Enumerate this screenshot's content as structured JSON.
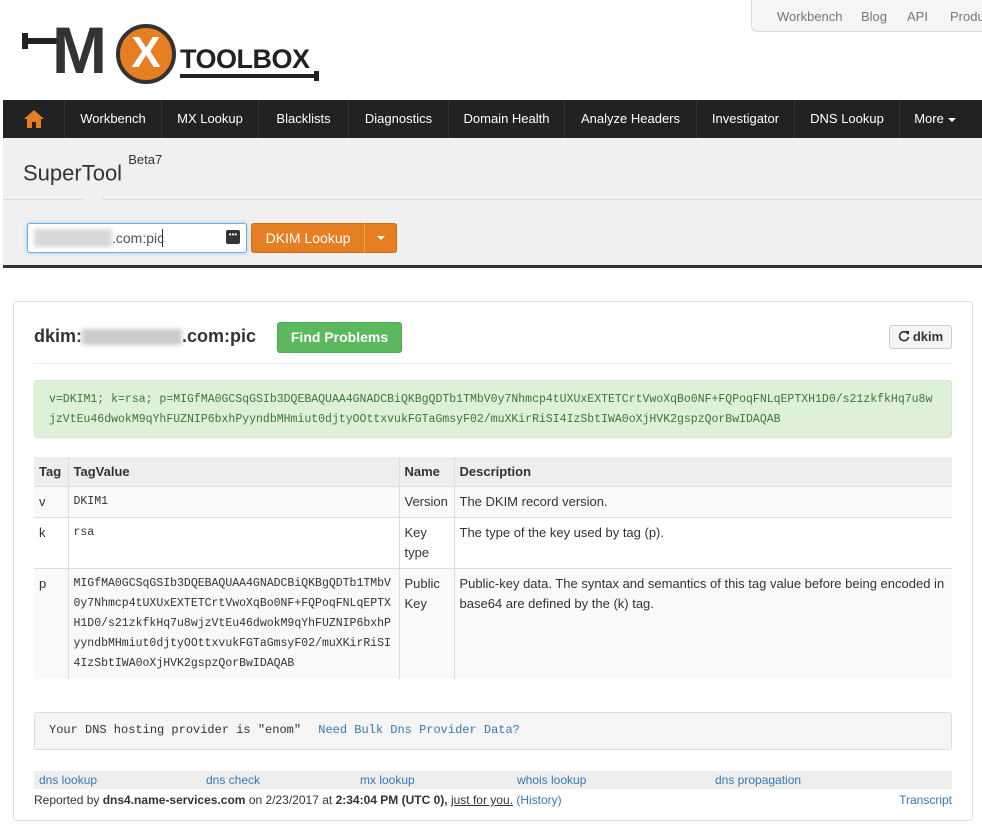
{
  "header": {
    "logo_text": "TOOLBOX",
    "logo_m": "M",
    "logo_x": "X",
    "top_links": [
      "Workbench",
      "Blog",
      "API",
      "Produ"
    ]
  },
  "nav": {
    "items": [
      "Workbench",
      "MX Lookup",
      "Blacklists",
      "Diagnostics",
      "Domain Health",
      "Analyze Headers",
      "Investigator",
      "DNS Lookup",
      "More"
    ]
  },
  "supertool": {
    "title": "SuperTool",
    "beta": "Beta7",
    "search_value": ".com:pic",
    "button_label": "DKIM Lookup"
  },
  "result": {
    "title_prefix": "dkim:",
    "title_suffix": ".com:pic",
    "find_problems_label": "Find Problems",
    "dkim_button_label": "dkim",
    "record": "v=DKIM1; k=rsa; p=MIGfMA0GCSqGSIb3DQEBAQUAA4GNADCBiQKBgQDTb1TMbV0y7Nhmcp4tUXUxEXTETCrtVwoXqBo0NF+FQPoqFNLqEPTXH1D0/s21zkfkHq7u8wjzVtEu46dwokM9qYhFUZNIP6bxhPyyndbMHmiut0djtyOOttxvukFGTaGmsyF02/muXKirRiSI4IzSbtIWA0oXjHVK2gspzQorBwIDAQAB",
    "table": {
      "headers": [
        "Tag",
        "TagValue",
        "Name",
        "Description"
      ],
      "rows": [
        [
          "v",
          "DKIM1",
          "Version",
          "The DKIM record version."
        ],
        [
          "k",
          "rsa",
          "Key type",
          "The type of the key used by tag (p)."
        ],
        [
          "p",
          "MIGfMA0GCSqGSIb3DQEBAQUAA4GNADCBiQKBgQDTb1TMbV0y7Nhmcp4tUXUxEXTETCrtVwoXqBo0NF+FQPoqFNLqEPTXH1D0/s21zkfkHq7u8wjzVtEu46dwokM9qYhFUZNIP6bxhPyyndbMHmiut0djtyOOttxvukFGTaGmsyF02/muXKirRiSI4IzSbtIWA0oXjHVK2gspzQorBwIDAQAB",
          "Public Key",
          "Public-key data. The syntax and semantics of this tag value before being encoded in base64 are defined by the (k) tag."
        ]
      ]
    },
    "provider_text": "Your DNS hosting provider is \"enom\"",
    "provider_link": "Need Bulk Dns Provider Data?",
    "footer_links": [
      "dns lookup",
      "dns check",
      "mx lookup",
      "whois lookup",
      "dns propagation"
    ],
    "report": {
      "prefix": "Reported by",
      "server": "dns4.name-services.com",
      "on": "on 2/23/2017 at",
      "time": "2:34:04 PM (UTC 0),",
      "just": "just for you.",
      "history": "(History)",
      "transcript": "Transcript"
    }
  },
  "colors": {
    "brand_orange": "#e67e22",
    "nav_bg": "#222222",
    "success_green": "#5cb85c",
    "record_bg": "#dff0d8",
    "link_blue": "#337ab7"
  }
}
